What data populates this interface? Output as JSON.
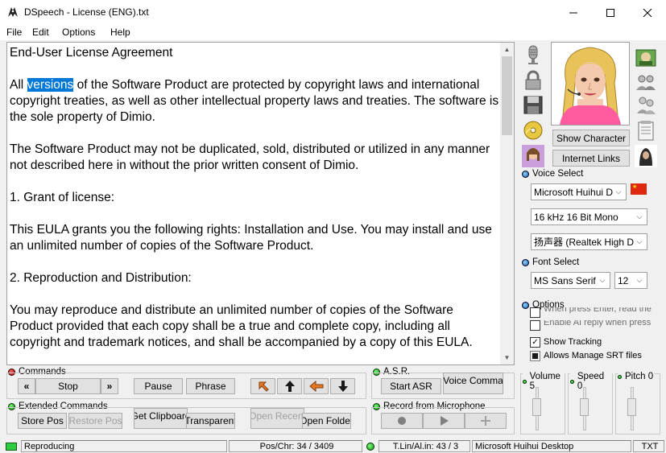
{
  "window": {
    "title": "DSpeech - License (ENG).txt"
  },
  "menu": [
    "File",
    "Edit",
    "Options",
    "Help"
  ],
  "editor": {
    "heading": "End-User License Agreement",
    "p1_before": "All ",
    "p1_selected": "versions",
    "p1_after": " of the Software Product are protected by copyright laws and international copyright treaties, as well as other intellectual property laws and treaties. The software is the sole property of Dimio.",
    "p2": "The Software Product may not be duplicated, sold, distributed or utilized in any manner not described here in without the prior written consent of Dimio.",
    "p3": "1. Grant of license:",
    "p4": "This EULA grants you the following rights: Installation and Use. You may install and use an unlimited number of copies of the Software Product.",
    "p5": "2. Reproduction and Distribution:",
    "p6": "You may reproduce and distribute an unlimited number of copies of the Software Product provided that each copy shall be a true and complete copy, including all copyright and trademark notices, and shall be accompanied by a copy of this EULA."
  },
  "character": {
    "show_label": "Show Character",
    "internet_label": "Internet Links"
  },
  "voice": {
    "label": "Voice Select",
    "voice": "Microsoft Huihui De",
    "format": "16 kHz 16 Bit Mono",
    "device": "扬声器 (Realtek High De"
  },
  "font": {
    "label": "Font Select",
    "name": "MS Sans Serif",
    "size": "12"
  },
  "options": {
    "label": "Options",
    "items": [
      {
        "text": "When press Enter, read the",
        "checked": false
      },
      {
        "text": "Enable AI reply when press Enter",
        "checked": false
      },
      {
        "text": "Show Tracking",
        "checked": true
      },
      {
        "text": "Allows Manage SRT files",
        "checked": false
      }
    ]
  },
  "commands": {
    "label": "Commands",
    "stop": "Stop",
    "pause": "Pause",
    "phrase": "Phrase"
  },
  "asr": {
    "label": "A.S.R.",
    "start": "Start ASR",
    "voice_cmd": "Voice Comma"
  },
  "extended": {
    "label": "Extended Commands",
    "store": "Store Pos",
    "restore": "Restore Pos",
    "clipboard": "Get Clipboard",
    "transparent": "Transparent",
    "open_recent": "Open Recent",
    "open_folder": "Open Folder"
  },
  "record": {
    "label": "Record from Microphone"
  },
  "sliders": {
    "volume": "Volume 5",
    "speed": "Speed 0",
    "pitch": "Pitch 0"
  },
  "status": {
    "state": "Reproducing",
    "pos": "Pos/Chr: 34 / 3409",
    "line": "T.Lin/Al.in: 43 / 3",
    "engine": "Microsoft Huihui Desktop",
    "type": "TXT"
  },
  "colors": {
    "selection": "#0078d7",
    "arrow_orange": "#e87722",
    "flag_red": "#de2910"
  }
}
